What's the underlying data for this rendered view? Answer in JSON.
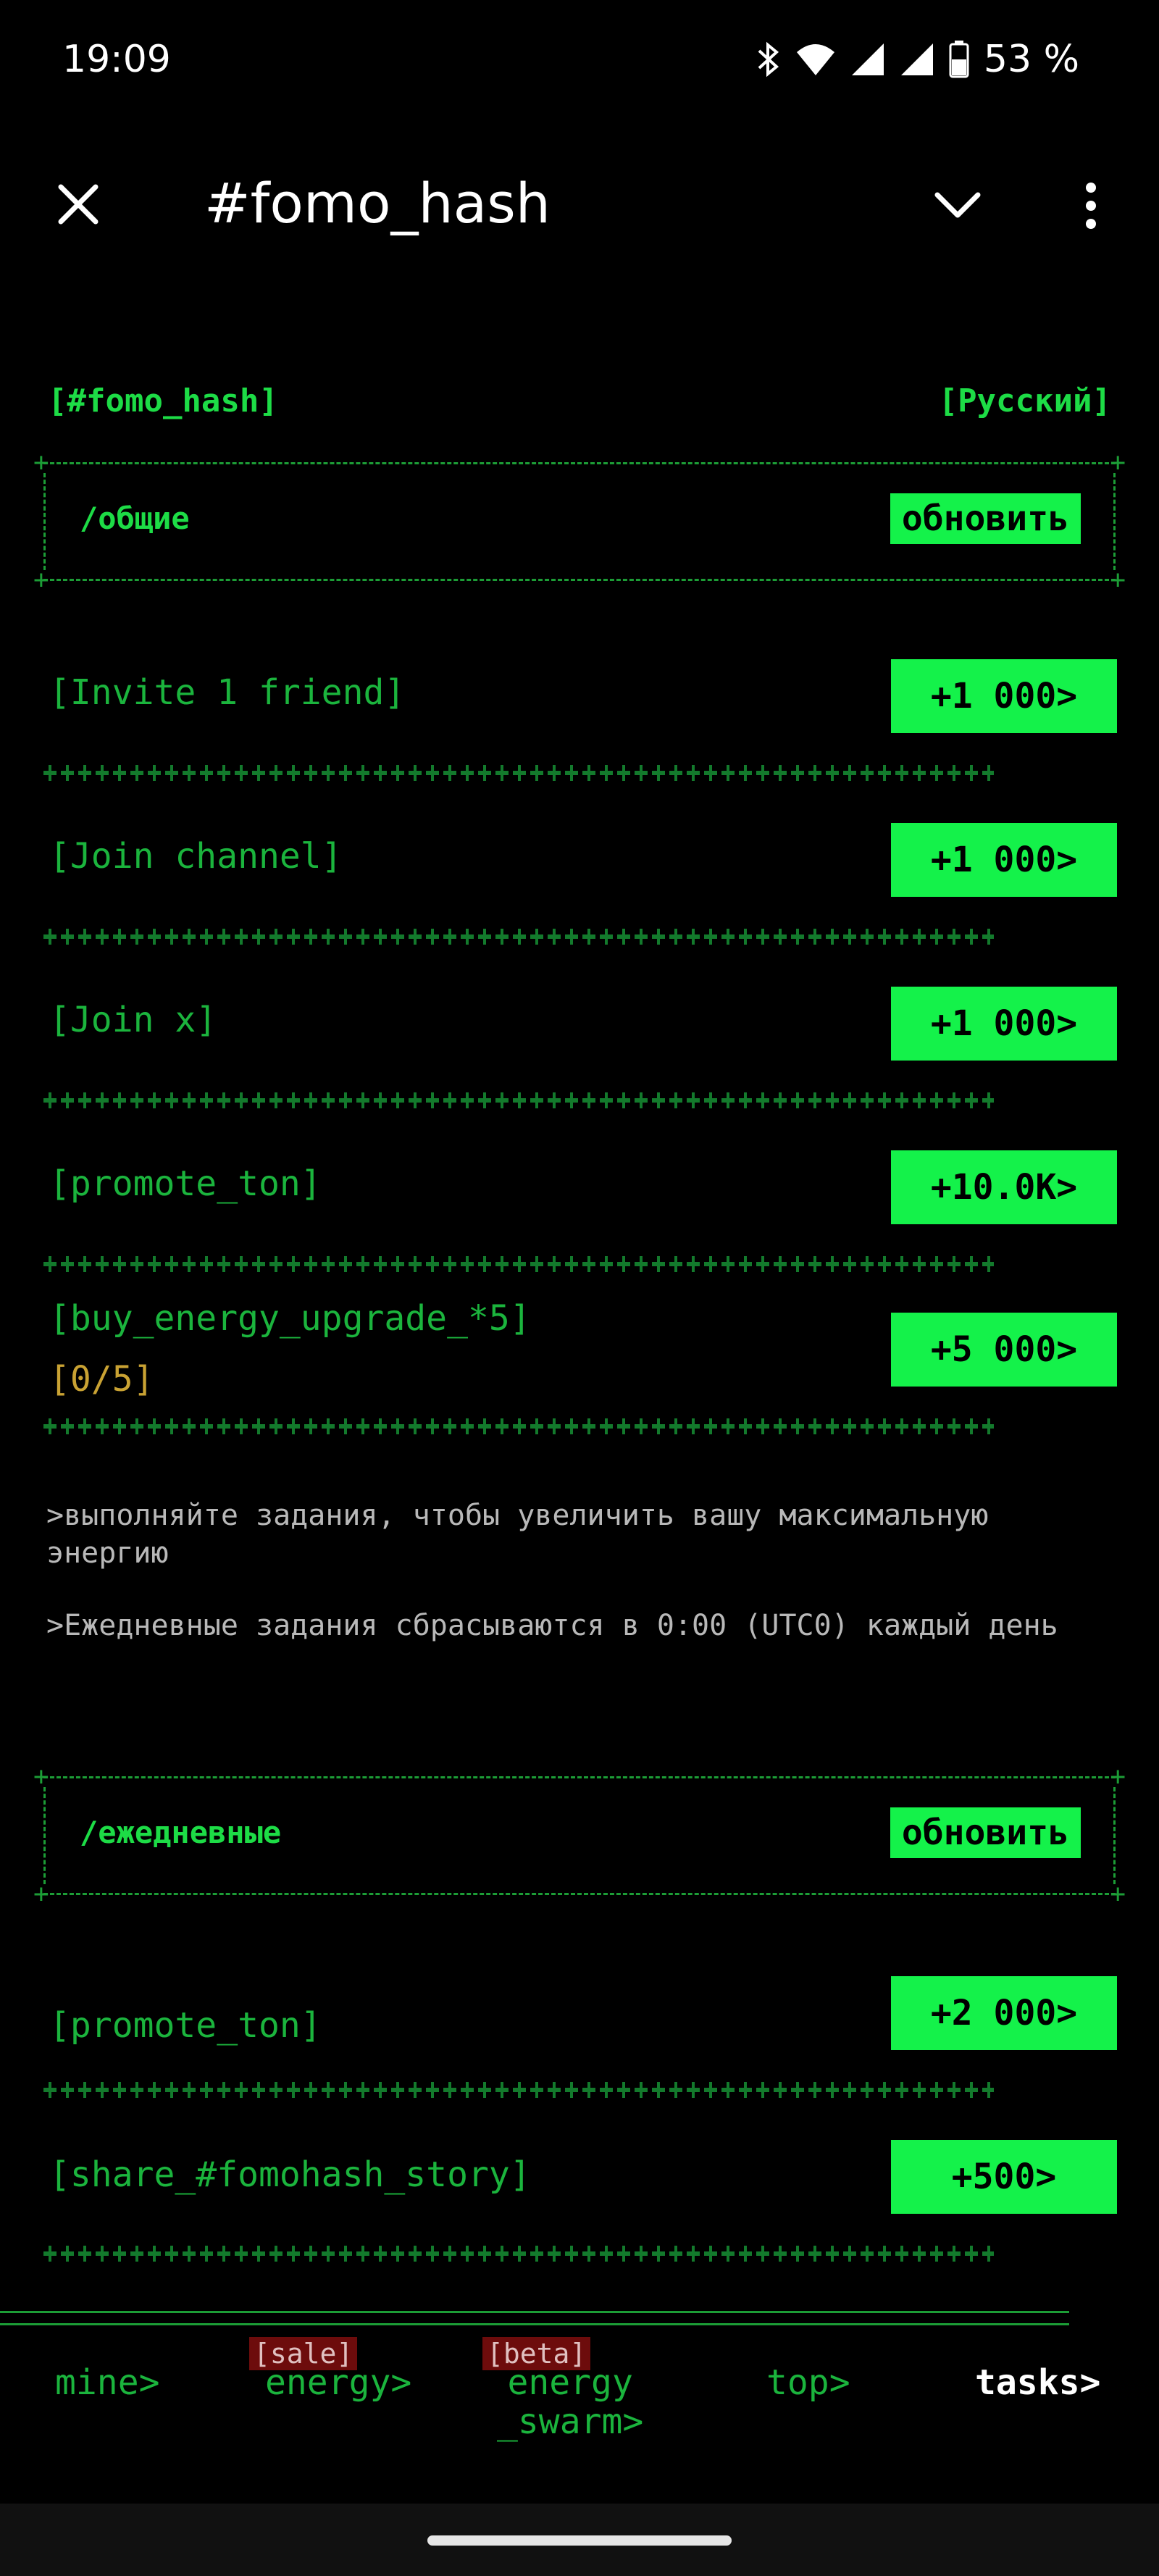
{
  "status_bar": {
    "time": "19:09",
    "battery": "53 %",
    "icons": [
      "bluetooth-icon",
      "wifi-icon",
      "signal-icon",
      "signal-icon",
      "battery-icon"
    ]
  },
  "app_bar": {
    "title": "#fomo_hash",
    "icons": [
      "close-icon",
      "chevron-down-icon",
      "more-vertical-icon"
    ]
  },
  "header": {
    "brand": "[#fomo_hash]",
    "language": "[Русский]"
  },
  "general_section": {
    "title": "/общие",
    "refresh_label": "обновить",
    "tasks": [
      {
        "label": "[Invite 1 friend]",
        "reward": "+1 000>"
      },
      {
        "label": "[Join channel]",
        "reward": "+1 000>"
      },
      {
        "label": "[Join x]",
        "reward": "+1 000>"
      },
      {
        "label": "[promote_ton]",
        "reward": "+10.0K>"
      },
      {
        "label": "[buy_energy_upgrade_*5]",
        "progress": "[0/5]",
        "reward": "+5 000>"
      }
    ]
  },
  "info": {
    "line1": ">выполняйте задания, чтобы увеличить вашу максимальную энергию",
    "line2": ">Ежедневные задания сбрасываются в 0:00 (UTC0) каждый день"
  },
  "daily_section": {
    "title": "/ежедневные",
    "refresh_label": "обновить",
    "tasks": [
      {
        "label": "[promote_ton]",
        "reward": "+2 000>"
      },
      {
        "label": "[share_#fomohash_story]",
        "reward": "+500>"
      }
    ]
  },
  "bottom_nav": {
    "items": [
      {
        "label": "mine>"
      },
      {
        "label": "energy>",
        "badge": "[sale]"
      },
      {
        "label": "energy\n_swarm>",
        "badge": "[beta]"
      },
      {
        "label": "top>"
      },
      {
        "label": "tasks>",
        "active": true
      }
    ]
  },
  "colors": {
    "accent": "#14f24a",
    "text_green": "#1bb43d",
    "progress": "#c9a233",
    "badge_bg": "#6d0c0c",
    "background": "#000000"
  }
}
